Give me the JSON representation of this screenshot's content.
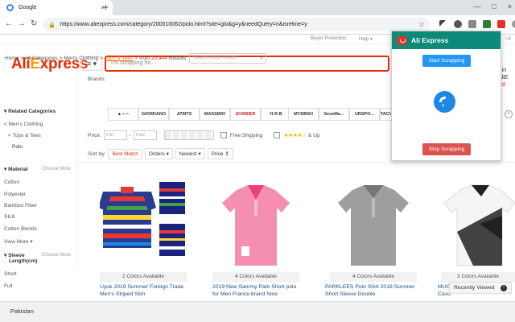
{
  "browser": {
    "tab_title": "Google",
    "tab_close": "×",
    "new_tab": "+",
    "window_controls": [
      "—",
      "□",
      "×"
    ],
    "nav": {
      "back": "←",
      "forward": "→",
      "reload": "↻"
    },
    "url": "https://www.aliexpress.com/category/200010062/polo.html?site=glo&g=y&needQuery=n&isrefine=y",
    "lock_icon": "lock-icon",
    "star_icon": "☆"
  },
  "site": {
    "topstrip": {
      "buyer_protection": "Buyer Protection",
      "help": "Help ▾",
      "lang": "La"
    },
    "logo": {
      "ali": "Ali",
      "x": "E",
      "rest": "xpress"
    },
    "menu_label": "≡ ▾",
    "search_placeholder": "I'm shopping for...",
    "signin": {
      "line1": "gn in",
      "line2": "y AliE",
      "line3": "ions!"
    }
  },
  "breadcrumb": {
    "home": "Home",
    "all": "All Categories",
    "mens": "Men's Clothing",
    "tops": "Tops & Tees",
    "polo": "Polo",
    "count": "20,444",
    "results": "Results",
    "within_placeholder": "Search within results"
  },
  "sidebar": {
    "related_title": "▾ Related Categories",
    "related": [
      "< Men's Clothing",
      "< Tops & Tees",
      "Polo"
    ],
    "material_title": "▾ Material",
    "choose_more": "Choose More",
    "materials": [
      "Cotton",
      "Polyester",
      "Bamboo Fiber",
      "SILK",
      "Cotton Blends"
    ],
    "view_more": "View More ▾",
    "sleeve_title": "▾ Sleeve",
    "sleeve_title2": "Length(cm)",
    "sleeve": [
      "Short",
      "Full"
    ]
  },
  "filters": {
    "brands_label": "Brands:",
    "brands": [
      "▲∽∽",
      "GIORDANO",
      "ATMTS",
      "MASSIMO",
      "SHABIER",
      "H·R·B",
      "MYDBSH",
      "SexeMa...",
      "URSPO...",
      "TACV"
    ],
    "price_label": "Price:",
    "min": "min",
    "dash": "-",
    "max": "max",
    "free_shipping": "Free Shipping",
    "stars": "★★★★☆",
    "up": "& Up",
    "sort_label": "Sort by:",
    "sort": [
      "Best Match",
      "Orders ▾",
      "Newest ▾",
      "Price ⇕"
    ]
  },
  "products": [
    {
      "avail": "2 Colors Available",
      "title": "Uyuk 2019 Summer Foreign Trade Men's Striped Slim"
    },
    {
      "avail": "4 Colors Available",
      "title": "2019 New Sammy Park Short polo for Men France brand Nice"
    },
    {
      "avail": "4 Colors Available",
      "title": "PARKLEES Polo Shirt 2018 Summer Short Sleeve Double"
    },
    {
      "avail": "3 Colors Available",
      "title": "MUGIL Casu"
    }
  ],
  "recent": {
    "label": "Recently Viewed",
    "icon": "⌃"
  },
  "popup": {
    "title": "Ali Express",
    "start": "Start Scrapping",
    "stop": "Stop Scrapping"
  },
  "bottombar": {
    "country": "Pakistan"
  },
  "colors": {
    "brand_red": "#e62e04",
    "popup_teal": "#0e8a7a",
    "start_blue": "#2196f3",
    "stop_red": "#d9534f"
  }
}
